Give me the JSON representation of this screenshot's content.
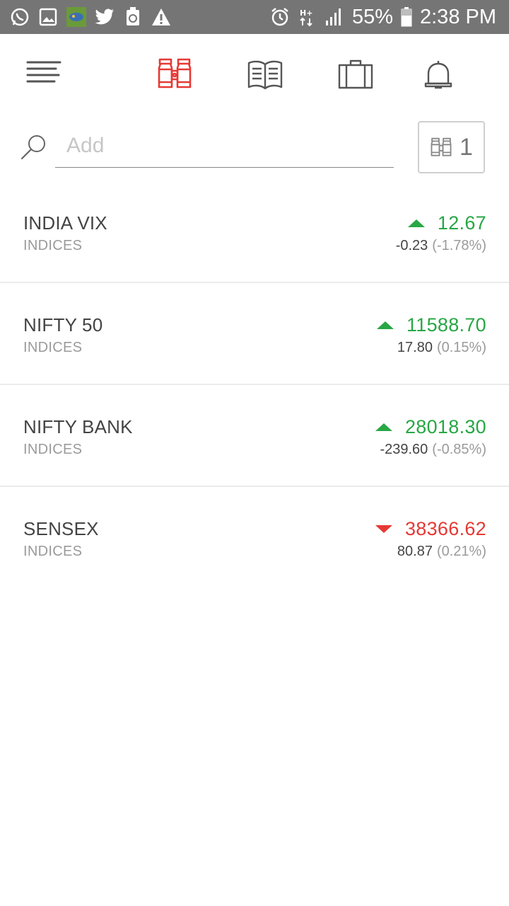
{
  "status_bar": {
    "battery": "55%",
    "time": "2:38 PM",
    "network": "H+",
    "left_icons": [
      "whatsapp-icon",
      "gallery-icon",
      "game-app-icon",
      "twitter-icon",
      "recycle-icon",
      "warning-icon"
    ],
    "right_icons": [
      "alarm-icon",
      "network-icon",
      "signal-icon",
      "battery-icon"
    ]
  },
  "nav": {
    "items": [
      "menu-icon",
      "binoculars-icon",
      "book-icon",
      "briefcase-icon",
      "bell-icon"
    ],
    "active": "binoculars-icon"
  },
  "search": {
    "placeholder": "Add",
    "value": ""
  },
  "watchlist_button": {
    "count": "1"
  },
  "colors": {
    "accent": "#e53935",
    "up": "#28a745",
    "down": "#e53935",
    "statusbar": "#757575"
  },
  "rows": [
    {
      "name": "INDIA VIX",
      "exchange": "INDICES",
      "price": "12.67",
      "change": "-0.23",
      "pct": "(-1.78%)",
      "direction": "up"
    },
    {
      "name": "NIFTY 50",
      "exchange": "INDICES",
      "price": "11588.70",
      "change": "17.80",
      "pct": "(0.15%)",
      "direction": "up"
    },
    {
      "name": "NIFTY BANK",
      "exchange": "INDICES",
      "price": "28018.30",
      "change": "-239.60",
      "pct": "(-0.85%)",
      "direction": "up"
    },
    {
      "name": "SENSEX",
      "exchange": "INDICES",
      "price": "38366.62",
      "change": "80.87",
      "pct": "(0.21%)",
      "direction": "down"
    }
  ]
}
